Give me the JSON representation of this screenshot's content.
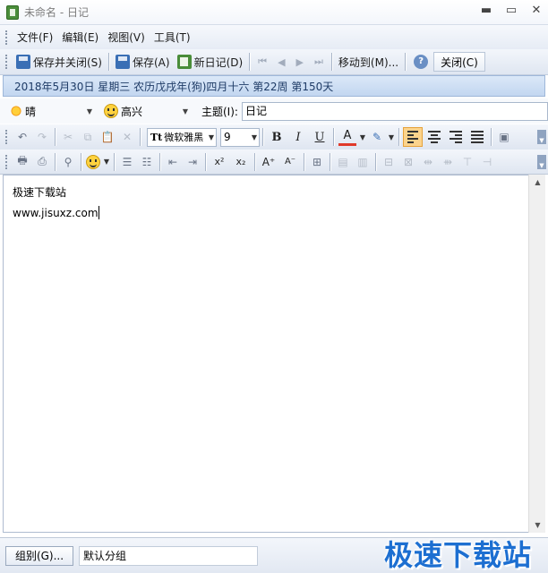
{
  "window": {
    "title": "未命名 - 日记"
  },
  "menubar": {
    "items": [
      "文件(F)",
      "编辑(E)",
      "视图(V)",
      "工具(T)"
    ]
  },
  "toolbar": {
    "save_close_label": "保存并关闭(S)",
    "save_label": "保存(A)",
    "new_diary_label": "新日记(D)",
    "move_to_label": "移动到(M)...",
    "close_label": "关闭(C)"
  },
  "date_banner": "2018年5月30日  星期三  农历戊戌年(狗)四月十六   第22周  第150天",
  "meta": {
    "weather": "晴",
    "mood": "高兴",
    "subject_label": "主题(I):",
    "subject_value": "日记"
  },
  "format": {
    "font_name": "微软雅黑",
    "font_size": "9",
    "bold": "B",
    "italic": "I",
    "underline": "U",
    "font_color_glyph": "A",
    "superscript": "x²",
    "subscript": "x₂",
    "grow_font": "A⁺",
    "shrink_font": "A⁻"
  },
  "editor": {
    "lines": [
      "极速下载站",
      "www.jisuxz.com"
    ]
  },
  "status": {
    "group_button_label": "组别(G)...",
    "group_value": "默认分组"
  },
  "watermark": "极速下载站",
  "colors": {
    "accent": "#1d6fd1",
    "active_toolbar": "#fbd38c",
    "date_banner_text": "#1e3b66"
  }
}
